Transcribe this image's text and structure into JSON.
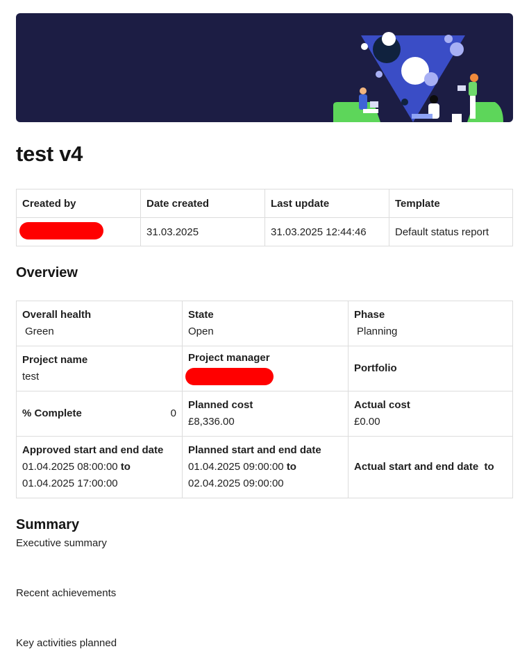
{
  "header": {
    "title": "test v4"
  },
  "meta_table": {
    "headers": [
      "Created by",
      "Date created",
      "Last update",
      "Template"
    ],
    "row": {
      "created_by": "",
      "date_created": "31.03.2025",
      "last_update": "31.03.2025 12:44:46",
      "template": "Default status report"
    },
    "redaction_color": "#ff0000"
  },
  "overview": {
    "heading": "Overview",
    "overall_health_label": "Overall health",
    "overall_health_value": "Green",
    "state_label": "State",
    "state_value": "Open",
    "phase_label": "Phase",
    "phase_value": "Planning",
    "project_name_label": "Project name",
    "project_name_value": "test",
    "project_manager_label": "Project manager",
    "portfolio_label": "Portfolio",
    "complete_label": "% Complete",
    "complete_value": "0",
    "planned_cost_label": "Planned cost",
    "planned_cost_value": "£8,336.00",
    "actual_cost_label": "Actual cost",
    "actual_cost_value": "£0.00",
    "approved_dates_label": "Approved start and end date",
    "approved_start": "01.04.2025 08:00:00",
    "approved_end": "01.04.2025 17:00:00",
    "planned_dates_label": "Planned start and end date",
    "planned_start": "01.04.2025 09:00:00",
    "planned_end": "02.04.2025 09:00:00",
    "actual_dates_label": "Actual start and end date",
    "to_word": "to"
  },
  "summary": {
    "heading": "Summary",
    "executive_summary": "Executive summary",
    "recent_achievements": "Recent achievements",
    "key_activities": "Key activities planned"
  },
  "colors": {
    "banner_bg": "#1c1d44",
    "banner_accent": "#3a4dc6",
    "banner_green": "#5dd65a"
  }
}
